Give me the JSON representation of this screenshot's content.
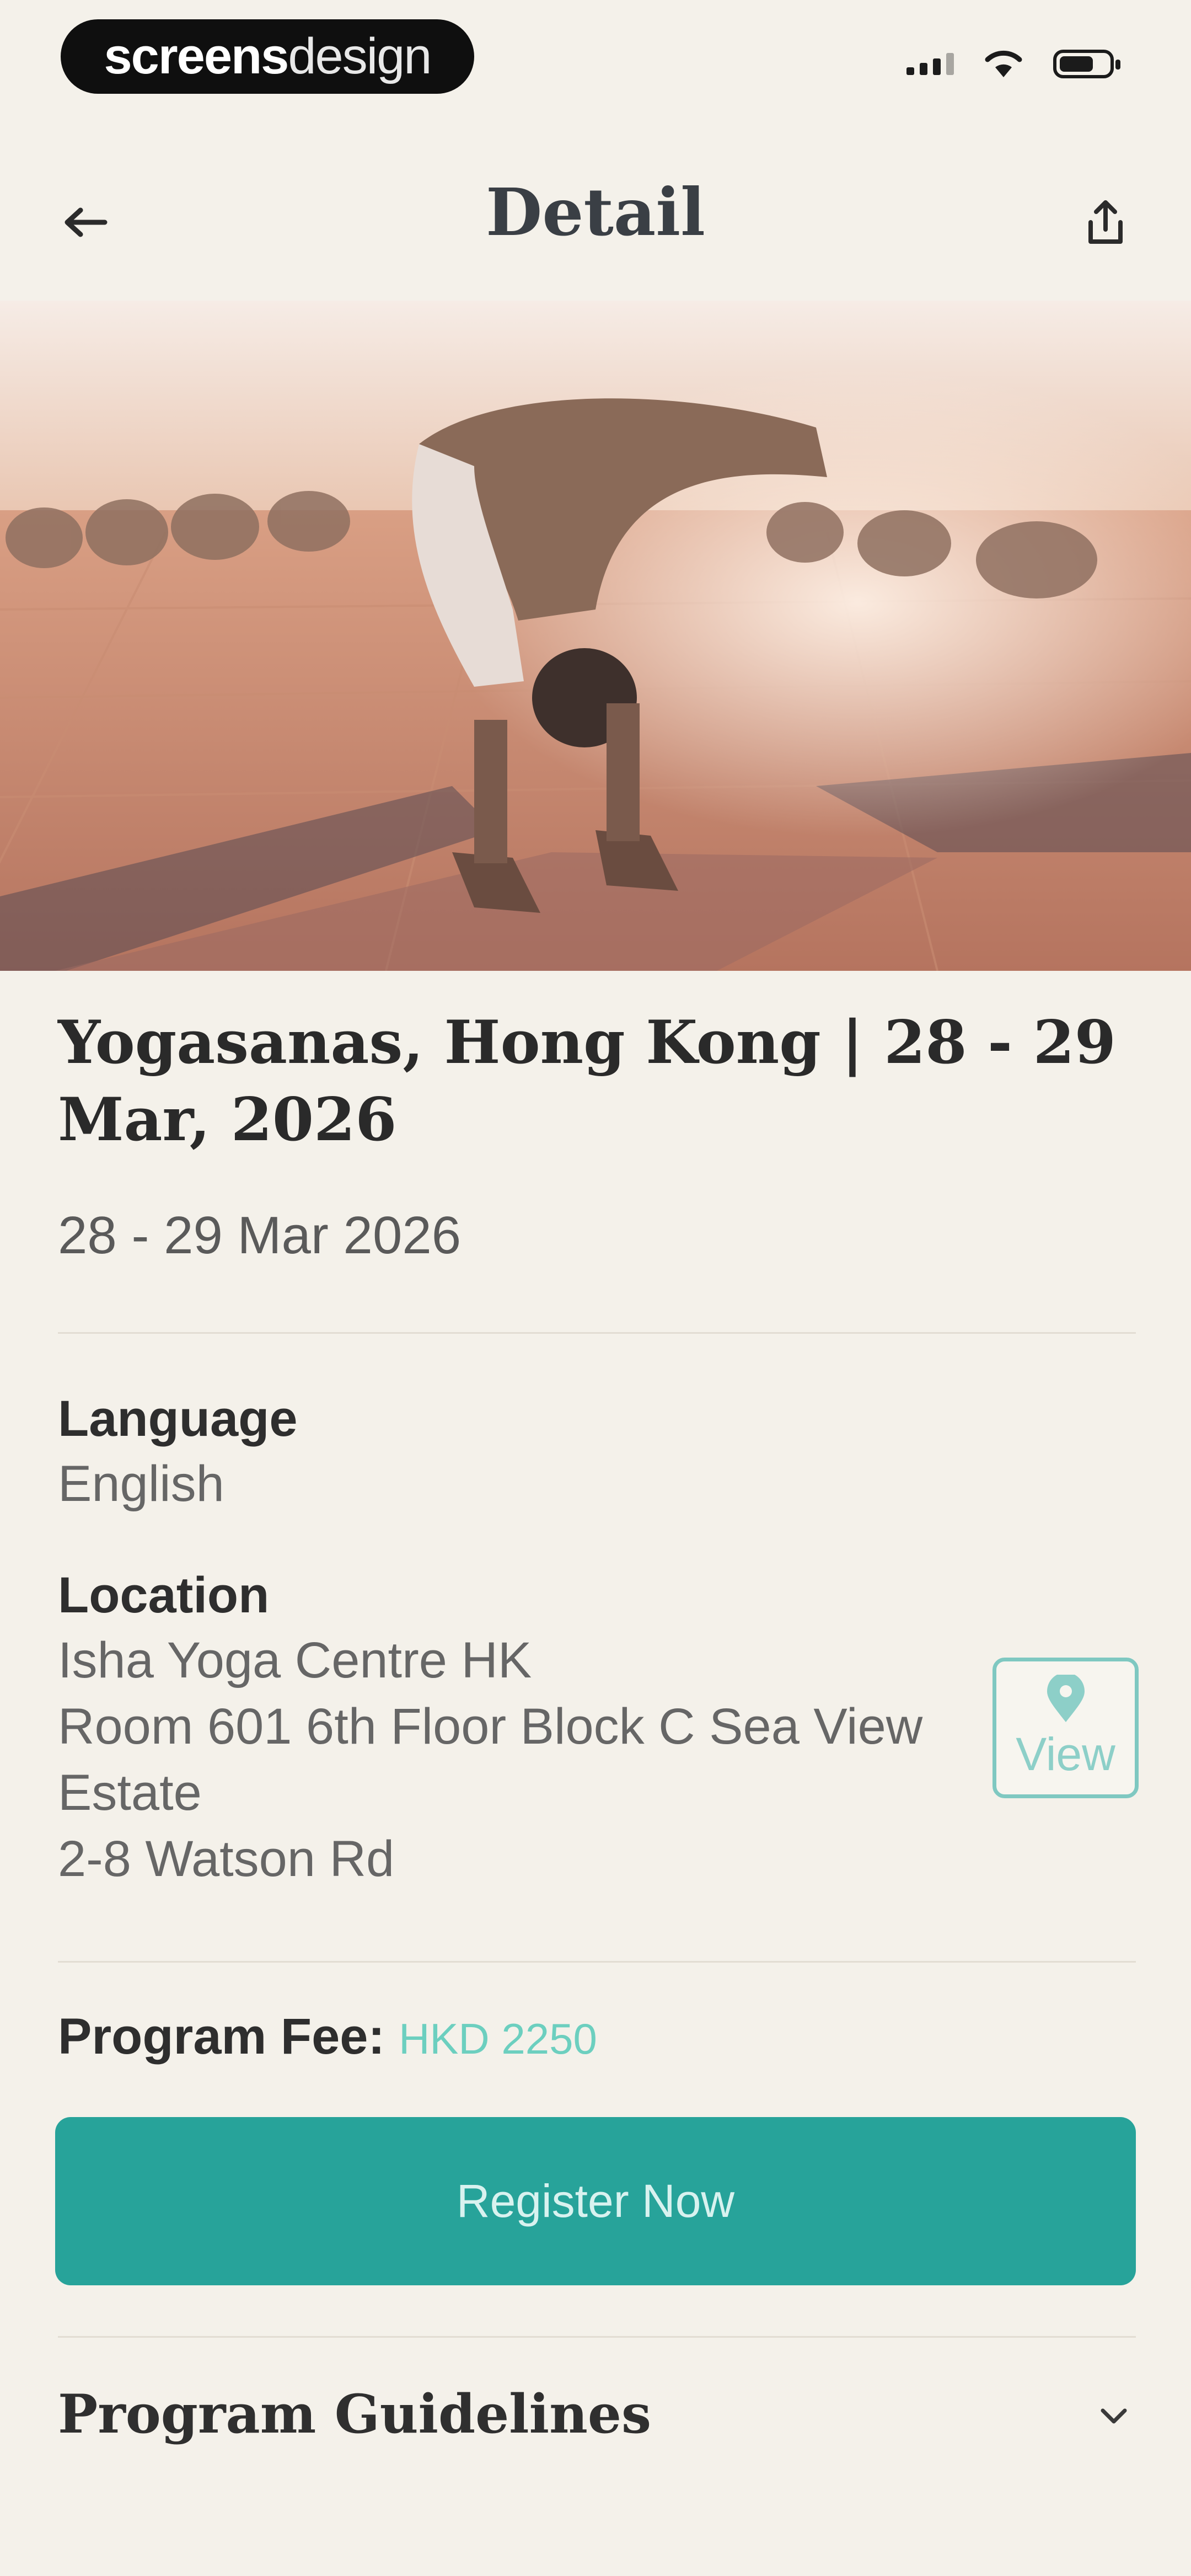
{
  "status_bar": {
    "brand_bold": "screens",
    "brand_light": "design"
  },
  "header": {
    "title": "Detail",
    "back_icon": "arrow-left-icon",
    "share_icon": "share-icon"
  },
  "hero": {
    "image": "photo-yoga-group-forward-bend"
  },
  "event": {
    "title": "Yogasanas, Hong Kong | 28 - 29 Mar, 2026",
    "date": "28 - 29 Mar 2026"
  },
  "details": {
    "language_label": "Language",
    "language_value": "English",
    "location_label": "Location",
    "location_lines": [
      "Isha Yoga Centre HK",
      "Room 601 6th Floor Block C Sea View",
      "Estate",
      "2-8 Watson Rd"
    ],
    "view_label": "View",
    "view_icon": "map-pin-icon"
  },
  "fee": {
    "label": "Program Fee:",
    "value": "HKD 2250"
  },
  "actions": {
    "register_label": "Register Now"
  },
  "guidelines": {
    "title": "Program Guidelines",
    "icon": "chevron-down-icon"
  },
  "colors": {
    "background": "#f4f1ea",
    "accent": "#27a39a",
    "fee_text": "#6ccfbf"
  }
}
